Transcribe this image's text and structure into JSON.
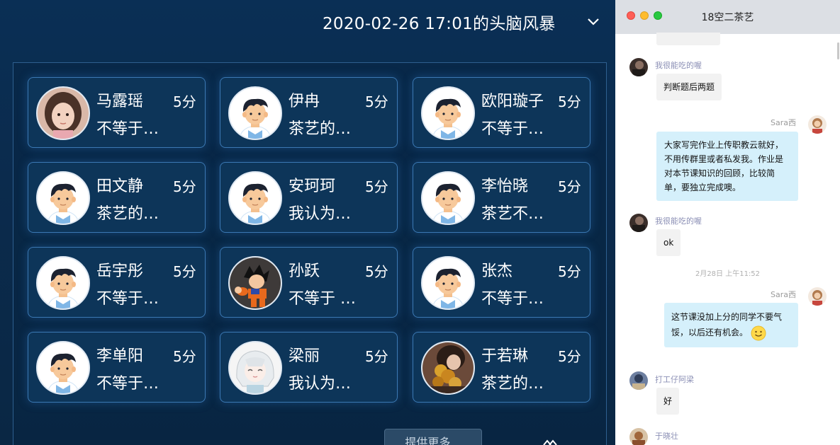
{
  "brainstorm": {
    "title": "2020-02-26 17:01的头脑风暴",
    "bottom_button_label": "提供更多...",
    "cards": [
      {
        "name": "马露瑶",
        "score": "5分",
        "text": "不等于…",
        "avatar": "photo-girl-avatar"
      },
      {
        "name": "伊冉",
        "score": "5分",
        "text": "茶艺的…",
        "avatar": "default-boy-avatar"
      },
      {
        "name": "欧阳璇子",
        "score": "5分",
        "text": "不等于…",
        "avatar": "default-boy-avatar"
      },
      {
        "name": "田文静",
        "score": "5分",
        "text": "茶艺的…",
        "avatar": "default-boy-avatar"
      },
      {
        "name": "安珂珂",
        "score": "5分",
        "text": "我认为…",
        "avatar": "default-boy-avatar"
      },
      {
        "name": "李怡晓",
        "score": "5分",
        "text": "茶艺不…",
        "avatar": "default-boy-avatar"
      },
      {
        "name": "岳宇彤",
        "score": "5分",
        "text": "不等于…",
        "avatar": "default-boy-avatar"
      },
      {
        "name": "孙跃",
        "score": "5分",
        "text": "不等于 …",
        "avatar": "cartoon-fighter-avatar"
      },
      {
        "name": "张杰",
        "score": "5分",
        "text": "不等于…",
        "avatar": "default-boy-avatar"
      },
      {
        "name": "李单阳",
        "score": "5分",
        "text": "不等于…",
        "avatar": "default-boy-avatar"
      },
      {
        "name": "梁丽",
        "score": "5分",
        "text": "我认为…",
        "avatar": "anime-girl-avatar"
      },
      {
        "name": "于若琳",
        "score": "5分",
        "text": "茶艺的…",
        "avatar": "photo-flowers-avatar"
      }
    ]
  },
  "chat": {
    "title": "18空二茶艺",
    "messages": [
      {
        "sender": "我很能吃的喔",
        "text": "判断题后两题"
      },
      {
        "sender": "Sara西",
        "text": "大家写完作业上传职教云就好，不用传群里或者私发我。作业是对本节课知识的回顾，比较简单，要独立完成噢。"
      },
      {
        "sender": "我很能吃的喔",
        "text": "ok"
      },
      {
        "sender": "Sara西",
        "text": "这节课没加上分的同学不要气馁，以后还有机会。"
      },
      {
        "sender": "打工仔阿梁",
        "text": "好"
      },
      {
        "sender": "于晓壮",
        "text": ""
      }
    ],
    "time_separator": "2月28日  上午11:52",
    "icons": {
      "smiley": "smiley-emoji-icon"
    }
  },
  "colors": {
    "accent_blue": "#3b78b3",
    "panel_bg": "#0b2b4d",
    "bubble_blue": "#d5f0fb",
    "bubble_gray": "#f2f2f2"
  }
}
